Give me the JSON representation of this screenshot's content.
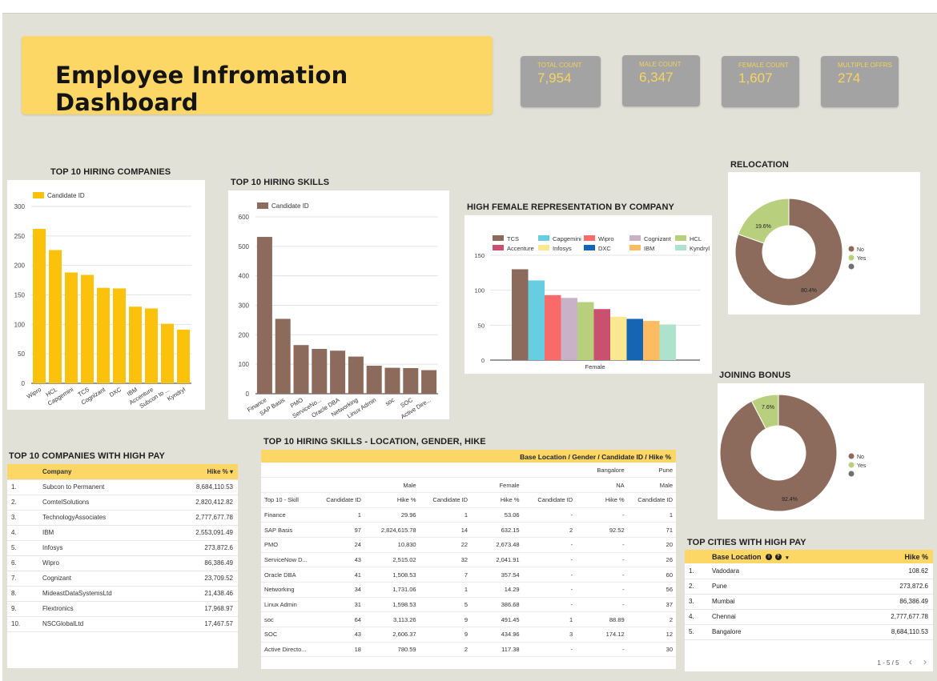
{
  "title": "Employee Infromation Dashboard",
  "kpis": [
    {
      "label": "TOTAL COUNT",
      "value": "7,954"
    },
    {
      "label": "MALE COUNT",
      "value": "6,347"
    },
    {
      "label": "FEMALE COUNT",
      "value": "1,607"
    },
    {
      "label": "MULTIPLE OFFRS",
      "value": "274"
    }
  ],
  "colors": {
    "accent": "#fcd766",
    "kpi_bg": "#a3a3a3",
    "bar_yellow": "#fcc20b",
    "bar_brown": "#8c6a5c",
    "canvas": "#e2e1d8"
  },
  "top_companies_chart": {
    "title": "TOP 10 HIRING COMPANIES",
    "legend": "Candidate ID",
    "categories": [
      "Wipro",
      "HCL",
      "Capgemini",
      "TCS",
      "Cognizant",
      "DXC",
      "IBM",
      "Accenture",
      "Subcon to ...",
      "Kyndryl"
    ],
    "values": [
      262,
      226,
      188,
      184,
      162,
      161,
      130,
      127,
      101,
      91
    ],
    "yticks": [
      "300",
      "250",
      "200",
      "150",
      "100",
      "50",
      "0"
    ]
  },
  "top_skills_chart": {
    "title": "TOP 10 HIRING SKILLS",
    "legend": "Candidate ID",
    "categories": [
      "Finance",
      "SAP Basis",
      "PMO",
      "ServiceNo...",
      "Oracle DBA",
      "Networking",
      "Linux Admin",
      "soc",
      "SOC",
      "Active Dire..."
    ],
    "values": [
      532,
      254,
      165,
      152,
      146,
      126,
      95,
      88,
      87,
      80
    ],
    "yticks": [
      "600",
      "500",
      "400",
      "300",
      "200",
      "100",
      "0"
    ]
  },
  "female_chart": {
    "title": "HIGH FEMALE REPRESENTATION BY COMPANY",
    "xlabel": "Female",
    "yticks": [
      "150",
      "100",
      "50",
      "0"
    ]
  },
  "relocation": {
    "title": "RELOCATION",
    "legend": [
      "No",
      "Yes",
      ""
    ],
    "labels": [
      "19.6%",
      "80.4%"
    ]
  },
  "joining_bonus": {
    "title": "JOINING BONUS",
    "legend": [
      "No",
      "Yes",
      ""
    ],
    "labels": [
      "7.6%",
      "92.4%"
    ]
  },
  "high_pay_companies": {
    "title": "TOP 10 COMPANIES WITH HIGH PAY",
    "headers": [
      "Company",
      "Hike % ▾"
    ],
    "rows": [
      {
        "rank": "1.",
        "name": "Subcon to Permanent",
        "hike": "8,684,110.53"
      },
      {
        "rank": "2.",
        "name": "ComtelSolutions",
        "hike": "2,820,412.82"
      },
      {
        "rank": "3.",
        "name": "TechnologyAssociates",
        "hike": "2,777,677.78"
      },
      {
        "rank": "4.",
        "name": "IBM",
        "hike": "2,553,091.49"
      },
      {
        "rank": "5.",
        "name": "Infosys",
        "hike": "273,872.6"
      },
      {
        "rank": "6.",
        "name": "Wipro",
        "hike": "86,386.49"
      },
      {
        "rank": "7.",
        "name": "Cognizant",
        "hike": "23,709.52"
      },
      {
        "rank": "8.",
        "name": "MideastDataSystemsLtd",
        "hike": "21,438.46"
      },
      {
        "rank": "9.",
        "name": "Flextronics",
        "hike": "17,968.97"
      },
      {
        "rank": "10.",
        "name": "NSCGlobalLtd",
        "hike": "17,467.57"
      }
    ]
  },
  "pivot": {
    "title": "TOP 10 HIRING SKILLS - LOCATION, GENDER, HIKE",
    "header_bar": "Base Location / Gender / Candidate ID / Hike %",
    "loc_row": [
      "",
      "",
      "",
      "",
      "",
      "",
      "Bangalore",
      "Pune"
    ],
    "gender_row": [
      "",
      "",
      "Male",
      "",
      "Female",
      "",
      "NA",
      "Male"
    ],
    "col_row": [
      "Top 10 - Skill",
      "Candidate ID",
      "Hike %",
      "Candidate ID",
      "Hike %",
      "Candidate ID",
      "Hike %",
      "Candidate ID"
    ],
    "rows": [
      [
        "Finance",
        "1",
        "29.96",
        "1",
        "53.06",
        "-",
        "-",
        "1"
      ],
      [
        "SAP Basis",
        "97",
        "2,824,615.78",
        "14",
        "632.15",
        "2",
        "92.52",
        "71"
      ],
      [
        "PMO",
        "24",
        "10,830",
        "22",
        "2,673.48",
        "-",
        "-",
        "20"
      ],
      [
        "ServiceNow D...",
        "43",
        "2,515.02",
        "32",
        "2,041.91",
        "-",
        "-",
        "26"
      ],
      [
        "Oracle DBA",
        "41",
        "1,508.53",
        "7",
        "357.54",
        "-",
        "-",
        "60"
      ],
      [
        "Networking",
        "34",
        "1,731.06",
        "1",
        "14.29",
        "-",
        "-",
        "56"
      ],
      [
        "Linux Admin",
        "31",
        "1,598.53",
        "5",
        "386.68",
        "-",
        "-",
        "37"
      ],
      [
        "soc",
        "64",
        "3,113.26",
        "9",
        "491.45",
        "1",
        "88.89",
        "2"
      ],
      [
        "SOC",
        "43",
        "2,606.37",
        "9",
        "434.96",
        "3",
        "174.12",
        "12"
      ],
      [
        "Active Directo...",
        "18",
        "780.59",
        "2",
        "117.38",
        "-",
        "-",
        "30"
      ]
    ]
  },
  "cities": {
    "title": "TOP CITIES WITH HIGH PAY",
    "headers": [
      "Base Location",
      "Hike %"
    ],
    "rows": [
      {
        "rank": "1.",
        "name": "Vadodara",
        "hike": "108.62"
      },
      {
        "rank": "2.",
        "name": "Pune",
        "hike": "273,872.6"
      },
      {
        "rank": "3.",
        "name": "Mumbai",
        "hike": "86,386.49"
      },
      {
        "rank": "4.",
        "name": "Chennai",
        "hike": "2,777,677.78"
      },
      {
        "rank": "5.",
        "name": "Bangalore",
        "hike": "8,684,110.53"
      }
    ],
    "pagination": "1 - 5 / 5"
  },
  "chart_data": [
    {
      "type": "bar",
      "title": "TOP 10 HIRING COMPANIES",
      "categories": [
        "Wipro",
        "HCL",
        "Capgemini",
        "TCS",
        "Cognizant",
        "DXC",
        "IBM",
        "Accenture",
        "Subcon to ...",
        "Kyndryl"
      ],
      "series": [
        {
          "name": "Candidate ID",
          "values": [
            262,
            226,
            188,
            184,
            162,
            161,
            130,
            127,
            101,
            91
          ]
        }
      ],
      "ylim": [
        0,
        300
      ],
      "grid": true,
      "legend": "top-left"
    },
    {
      "type": "bar",
      "title": "TOP 10 HIRING SKILLS",
      "categories": [
        "Finance",
        "SAP Basis",
        "PMO",
        "ServiceNo...",
        "Oracle DBA",
        "Networking",
        "Linux Admin",
        "soc",
        "SOC",
        "Active Dire..."
      ],
      "series": [
        {
          "name": "Candidate ID",
          "values": [
            532,
            254,
            165,
            152,
            146,
            126,
            95,
            88,
            87,
            80
          ]
        }
      ],
      "ylim": [
        0,
        600
      ],
      "grid": true,
      "legend": "top-left"
    },
    {
      "type": "bar",
      "title": "HIGH FEMALE REPRESENTATION BY COMPANY",
      "categories": [
        "Female"
      ],
      "xlabel": "Female",
      "series": [
        {
          "name": "TCS",
          "values": [
            130
          ],
          "color": "#8c6a5c"
        },
        {
          "name": "Capgemini",
          "values": [
            114
          ],
          "color": "#67cde0"
        },
        {
          "name": "Wipro",
          "values": [
            93
          ],
          "color": "#f96b6b"
        },
        {
          "name": "Cognizant",
          "values": [
            89
          ],
          "color": "#c9b1c7"
        },
        {
          "name": "HCL",
          "values": [
            83
          ],
          "color": "#b8d07e"
        },
        {
          "name": "Accenture",
          "values": [
            73
          ],
          "color": "#c9506e"
        },
        {
          "name": "Infosys",
          "values": [
            62
          ],
          "color": "#fbe78f"
        },
        {
          "name": "DXC",
          "values": [
            59
          ],
          "color": "#1565b5"
        },
        {
          "name": "IBM",
          "values": [
            56
          ],
          "color": "#fcbc62"
        },
        {
          "name": "Kyndryl",
          "values": [
            51
          ],
          "color": "#ade3cd"
        }
      ],
      "ylim": [
        0,
        150
      ],
      "grid": true,
      "legend": "top"
    },
    {
      "type": "pie",
      "title": "RELOCATION",
      "categories": [
        "No",
        "Yes"
      ],
      "values": [
        80.4,
        19.6
      ],
      "colors": [
        "#8c6a5c",
        "#b8d07e"
      ],
      "legend": "right"
    },
    {
      "type": "pie",
      "title": "JOINING BONUS",
      "categories": [
        "No",
        "Yes"
      ],
      "values": [
        92.4,
        7.6
      ],
      "colors": [
        "#8c6a5c",
        "#b8d07e"
      ],
      "legend": "right"
    }
  ]
}
